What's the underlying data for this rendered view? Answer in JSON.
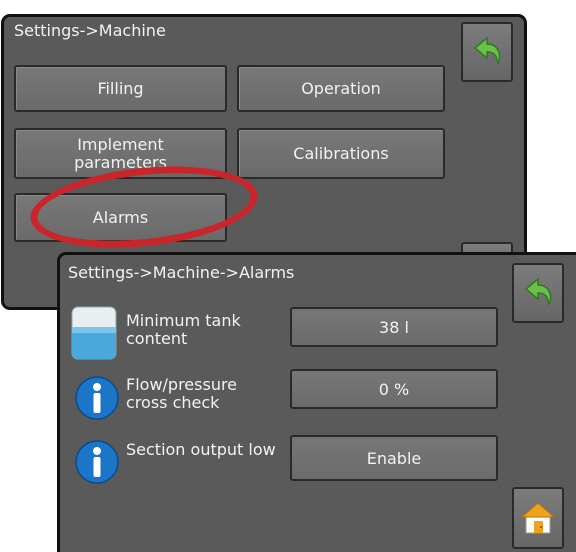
{
  "machine_screen": {
    "title": "Settings->Machine",
    "buttons": {
      "filling": "Filling",
      "operation": "Operation",
      "implement_parameters": "Implement parameters",
      "calibrations": "Calibrations",
      "alarms": "Alarms"
    },
    "back_icon": "green-back-arrow-icon"
  },
  "alarms_screen": {
    "title": "Settings->Machine->Alarms",
    "rows": [
      {
        "label": "Minimum tank content",
        "value": "38 l",
        "icon": "tank-icon"
      },
      {
        "label": "Flow/pressure cross check",
        "value": "0 %",
        "icon": "info-icon"
      },
      {
        "label": "Section output low",
        "value": "Enable",
        "icon": "info-icon"
      }
    ],
    "back_icon": "green-back-arrow-icon",
    "home_icon": "home-icon"
  },
  "colors": {
    "screen_bg": "#5a5a5a",
    "highlight": "#c9252b",
    "back_arrow": "#6cc04a",
    "info": "#1b75c9"
  }
}
